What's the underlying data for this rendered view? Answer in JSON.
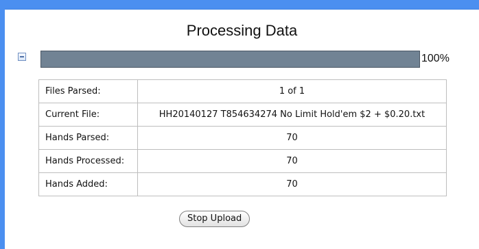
{
  "header": {
    "title": "Processing Data"
  },
  "progress": {
    "value": 100,
    "percent_label": "100%",
    "fill_color": "#718394"
  },
  "stats": {
    "rows": [
      {
        "label": "Files Parsed:",
        "value": "1 of 1"
      },
      {
        "label": "Current File:",
        "value": "HH20140127 T854634274 No Limit Hold'em $2 + $0.20.txt"
      },
      {
        "label": "Hands Parsed:",
        "value": "70"
      },
      {
        "label": "Hands Processed:",
        "value": "70"
      },
      {
        "label": "Hands Added:",
        "value": "70"
      }
    ]
  },
  "actions": {
    "stop_label": "Stop Upload"
  },
  "icons": {
    "collapse": "collapse-minus-icon"
  }
}
